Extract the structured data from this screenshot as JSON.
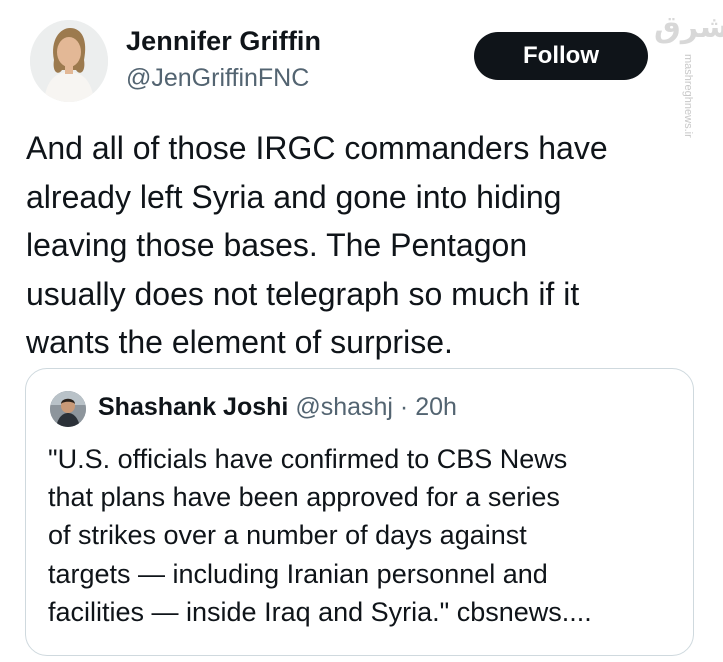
{
  "author": {
    "display_name": "Jennifer Griffin",
    "handle": "@JenGriffinFNC"
  },
  "follow_label": "Follow",
  "tweet_text": "And all of those IRGC commanders have\nalready left Syria and gone into hiding\nleaving those bases. The Pentagon\nusually does not telegraph so much if it\nwants the element of surprise.",
  "quote": {
    "display_name": "Shashank Joshi",
    "handle": "@shashj",
    "separator": "·",
    "time": "20h",
    "text": "\"U.S. officials have confirmed to CBS News\nthat plans have been approved for a series\nof strikes over a number of days against\ntargets — including Iranian personnel and\nfacilities — inside Iraq and Syria.\" cbsnews...."
  },
  "watermark": {
    "url": "mashreghnews.ir"
  },
  "colors": {
    "text": "#0f1419",
    "secondary": "#536471",
    "border": "#cfd9de",
    "button_bg": "#0f1419",
    "button_text": "#ffffff"
  },
  "icons": {
    "author_avatar": "profile-photo",
    "quote_avatar": "profile-photo",
    "watermark": "mashregh-logo"
  }
}
